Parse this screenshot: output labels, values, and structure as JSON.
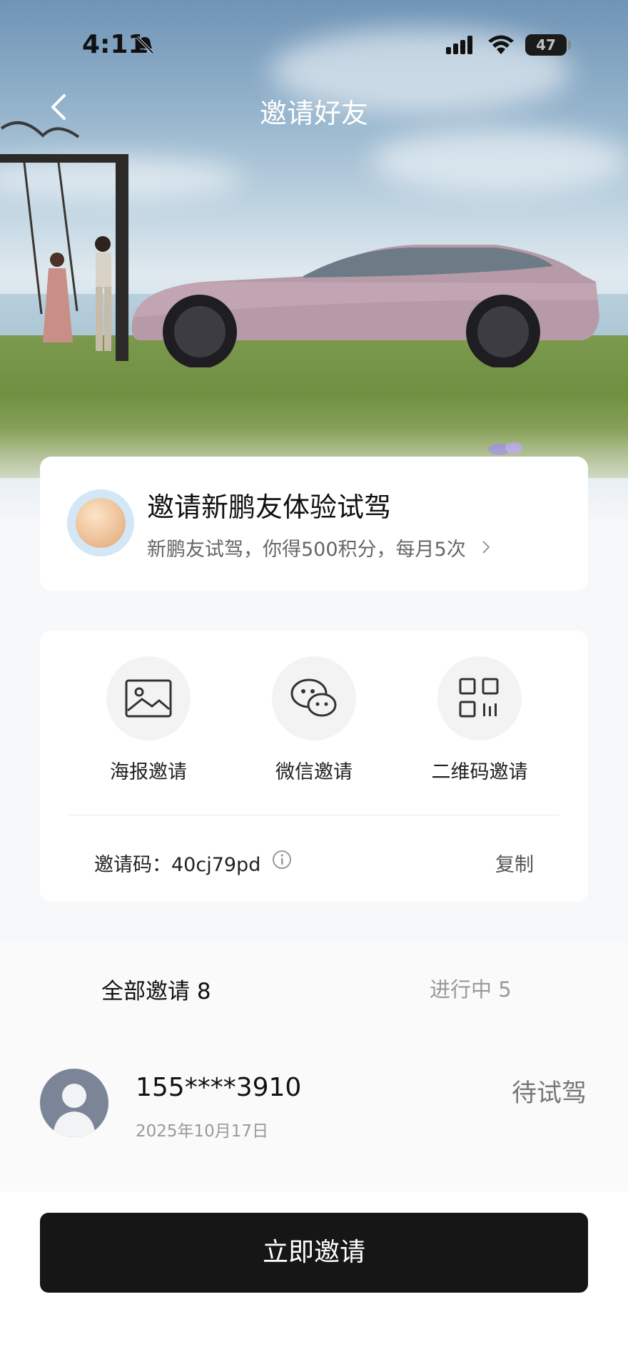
{
  "status_bar": {
    "time": "4:11",
    "battery": "47"
  },
  "nav": {
    "title": "邀请好友"
  },
  "promo": {
    "title": "邀请新鹏友体验试驾",
    "subtitle": "新鹏友试驾，你得500积分，每月5次"
  },
  "share_options": [
    {
      "label": "海报邀请",
      "icon": "image-icon"
    },
    {
      "label": "微信邀请",
      "icon": "wechat-icon"
    },
    {
      "label": "二维码邀请",
      "icon": "qrcode-icon"
    }
  ],
  "invite_code": {
    "label": "邀请码：40cj79pd",
    "copy_label": "复制"
  },
  "tabs": {
    "all": "全部邀请 8",
    "in_progress": "进行中 5"
  },
  "invites": [
    {
      "phone": "155****3910",
      "date": "2025年10月17日",
      "status": "待试驾"
    }
  ],
  "cta": {
    "label": "立即邀请"
  },
  "colors": {
    "cta_bg": "#161616",
    "accent_text": "#111111"
  }
}
